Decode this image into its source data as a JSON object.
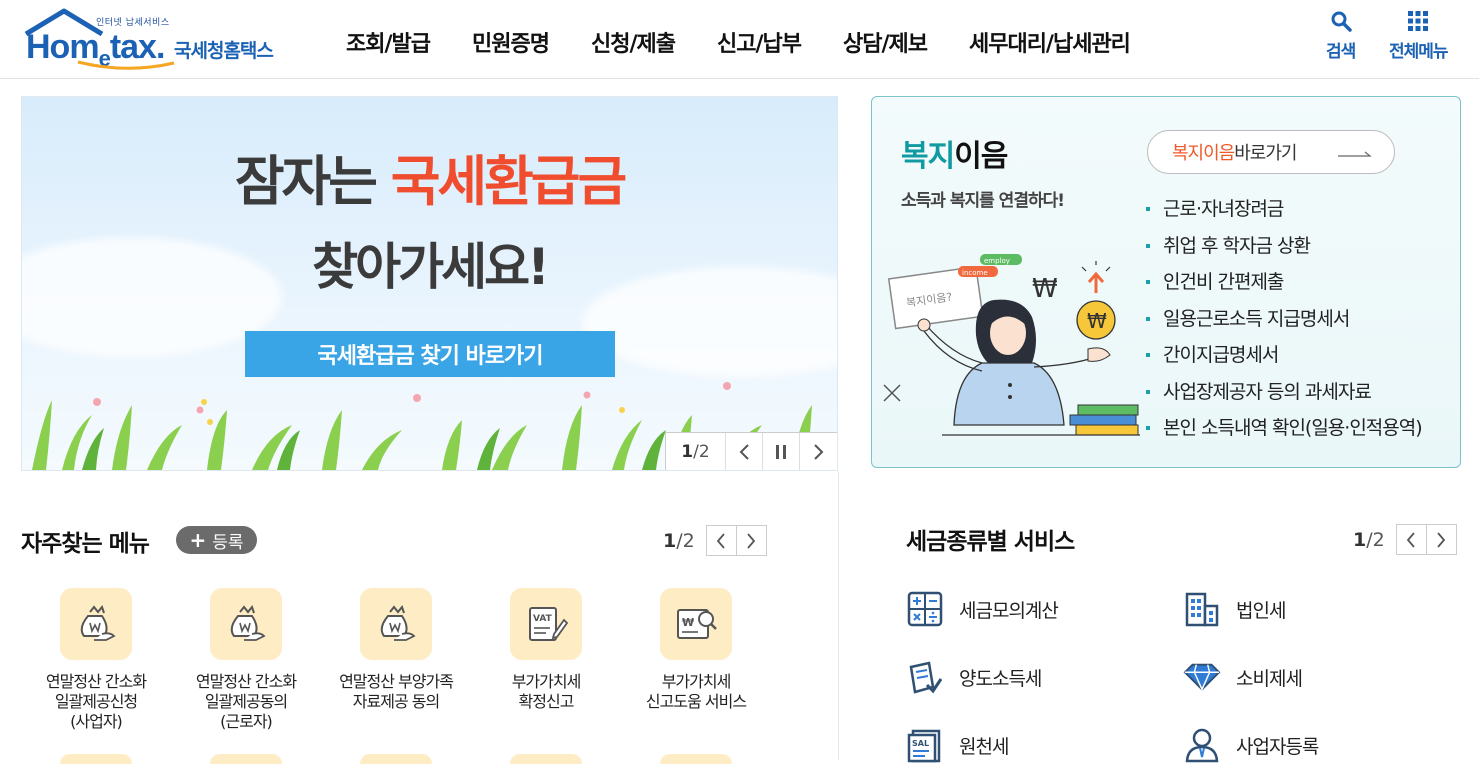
{
  "header": {
    "logo": {
      "tagline": "인터넷 납세서비스",
      "word_main": "Hom",
      "word_e": "e",
      "word_tail": "tax.",
      "korean": "국세청홈택스"
    },
    "nav": [
      {
        "label": "조회/발급"
      },
      {
        "label": "민원증명"
      },
      {
        "label": "신청/제출"
      },
      {
        "label": "신고/납부"
      },
      {
        "label": "상담/제보"
      },
      {
        "label": "세무대리/납세관리"
      }
    ],
    "search_label": "검색",
    "menu_label": "전체메뉴"
  },
  "banner": {
    "line1_plain": "잠자는 ",
    "line1_highlight": "국세환급금",
    "line2": "찾아가세요!",
    "button_label": "국세환급금 찾기 바로가기",
    "page_current": "1",
    "page_total": "/2"
  },
  "welfare": {
    "title_teal": "복지",
    "title_rest": "이음",
    "subtitle": "소득과 복지를 연결하다!",
    "link_orange": "복지이음",
    "link_rest": " 바로가기",
    "items": [
      {
        "label": "근로·자녀장려금"
      },
      {
        "label": "취업 후 학자금 상환"
      },
      {
        "label": "인건비 간편제출"
      },
      {
        "label": "일용근로소득 지급명세서"
      },
      {
        "label": "간이지급명세서"
      },
      {
        "label": "사업장제공자 등의 과세자료"
      },
      {
        "label": "본인 소득내역 확인(일용·인적용역)"
      }
    ],
    "illust_tags": [
      "employ",
      "income"
    ],
    "illust_card_text": "복지이음?"
  },
  "frequent": {
    "title": "자주찾는 메뉴",
    "register_label": "등록",
    "page_current": "1",
    "page_total": "/2",
    "items": [
      {
        "label": "연말정산 간소화\n일괄제공신청\n(사업자)",
        "icon": "money-bag-icon"
      },
      {
        "label": "연말정산 간소화\n일괄제공동의\n(근로자)",
        "icon": "money-bag-icon"
      },
      {
        "label": "연말정산 부양가족\n자료제공 동의",
        "icon": "money-bag-icon"
      },
      {
        "label": "부가가치세\n확정신고",
        "icon": "vat-document-icon"
      },
      {
        "label": "부가가치세\n신고도움 서비스",
        "icon": "won-search-icon"
      }
    ]
  },
  "tax_services": {
    "title": "세금종류별 서비스",
    "page_current": "1",
    "page_total": "/2",
    "items": [
      {
        "label": "세금모의계산",
        "icon": "calculator-icon"
      },
      {
        "label": "법인세",
        "icon": "building-icon"
      },
      {
        "label": "양도소득세",
        "icon": "document-check-icon"
      },
      {
        "label": "소비제세",
        "icon": "diamond-icon"
      },
      {
        "label": "원천세",
        "icon": "salary-doc-icon"
      },
      {
        "label": "사업자등록",
        "icon": "person-icon"
      }
    ]
  },
  "colors": {
    "brand_blue": "#1c62b4",
    "highlight_red": "#f04c2e",
    "banner_button": "#3aa5e6",
    "welfare_teal": "#109aa2",
    "quick_icon_bg": "#fdecc4"
  }
}
